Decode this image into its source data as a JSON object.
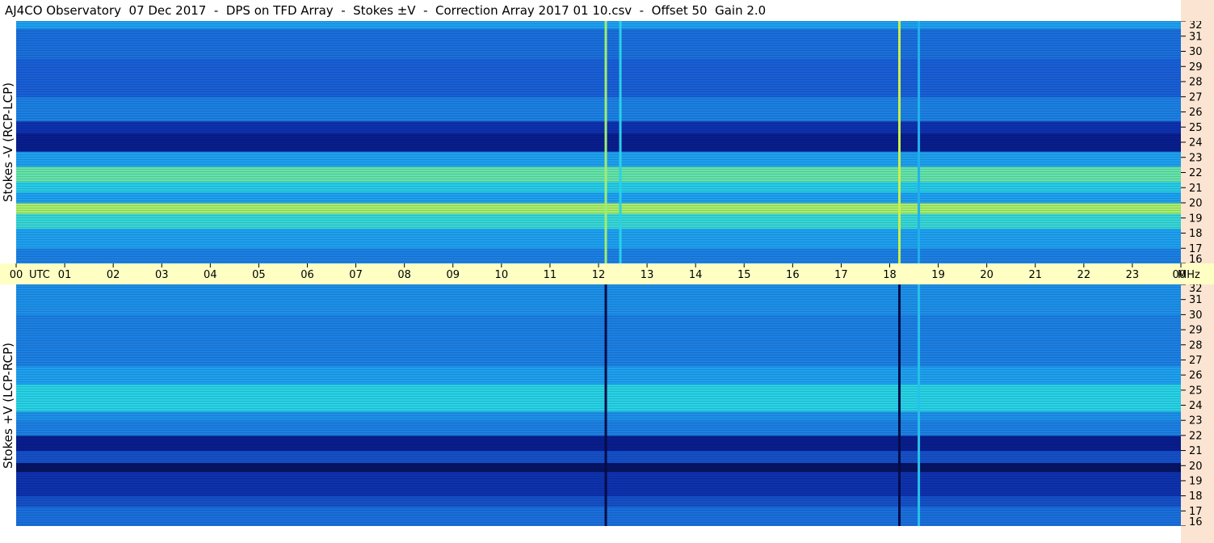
{
  "title": "AJ4CO Observatory  07 Dec 2017  -  DPS on TFD Array  -  Stokes ±V  -  Correction Array 2017 01 10.csv  -  Offset 50  Gain 2.0",
  "colors": {
    "background": "#ffffff",
    "utc_bar": "#ffffc4",
    "freq_strip": "#fbe5d2",
    "base_blue": "#1f6fd4"
  },
  "chart_data": {
    "type": "heatmap",
    "x_axis": {
      "unit_label": "UTC",
      "range_hours": [
        0,
        24
      ],
      "tick_labels": [
        "00",
        "01",
        "02",
        "03",
        "04",
        "05",
        "06",
        "07",
        "08",
        "09",
        "10",
        "11",
        "12",
        "13",
        "14",
        "15",
        "16",
        "17",
        "18",
        "19",
        "20",
        "21",
        "22",
        "23",
        "00"
      ]
    },
    "y_axis": {
      "unit_label": "MHz",
      "range_mhz": [
        16,
        32
      ],
      "tick_labels": [
        "16",
        "17",
        "18",
        "19",
        "20",
        "21",
        "22",
        "23",
        "24",
        "25",
        "26",
        "27",
        "28",
        "29",
        "30",
        "31",
        "32"
      ]
    },
    "panels": [
      {
        "label": "Stokes -V (RCP-LCP)",
        "freq_bands": [
          {
            "lo": 16.0,
            "hi": 17.0,
            "value": 0.45
          },
          {
            "lo": 17.0,
            "hi": 18.3,
            "value": 0.55
          },
          {
            "lo": 18.3,
            "hi": 19.3,
            "value": 0.72
          },
          {
            "lo": 19.3,
            "hi": 20.0,
            "value": 0.86
          },
          {
            "lo": 20.0,
            "hi": 20.7,
            "value": 0.55
          },
          {
            "lo": 20.7,
            "hi": 21.4,
            "value": 0.68
          },
          {
            "lo": 21.4,
            "hi": 22.4,
            "value": 0.78
          },
          {
            "lo": 22.4,
            "hi": 23.4,
            "value": 0.55
          },
          {
            "lo": 23.4,
            "hi": 24.6,
            "value": 0.12
          },
          {
            "lo": 24.6,
            "hi": 25.4,
            "value": 0.2
          },
          {
            "lo": 25.4,
            "hi": 27.0,
            "value": 0.45
          },
          {
            "lo": 27.0,
            "hi": 29.5,
            "value": 0.35
          },
          {
            "lo": 29.5,
            "hi": 31.5,
            "value": 0.4
          },
          {
            "lo": 31.5,
            "hi": 32.0,
            "value": 0.55
          }
        ],
        "vertical_lines": [
          {
            "utc": 12.15,
            "value": 0.85
          },
          {
            "utc": 12.45,
            "value": 0.7
          },
          {
            "utc": 18.2,
            "value": 0.9
          },
          {
            "utc": 18.6,
            "value": 0.6
          }
        ]
      },
      {
        "label": "Stokes +V (LCP-RCP)",
        "freq_bands": [
          {
            "lo": 16.0,
            "hi": 17.3,
            "value": 0.4
          },
          {
            "lo": 17.3,
            "hi": 18.0,
            "value": 0.3
          },
          {
            "lo": 18.0,
            "hi": 19.6,
            "value": 0.2
          },
          {
            "lo": 19.6,
            "hi": 20.2,
            "value": 0.05
          },
          {
            "lo": 20.2,
            "hi": 21.0,
            "value": 0.3
          },
          {
            "lo": 21.0,
            "hi": 22.0,
            "value": 0.12
          },
          {
            "lo": 22.0,
            "hi": 23.0,
            "value": 0.45
          },
          {
            "lo": 23.0,
            "hi": 23.6,
            "value": 0.5
          },
          {
            "lo": 23.6,
            "hi": 25.4,
            "value": 0.7
          },
          {
            "lo": 25.4,
            "hi": 26.6,
            "value": 0.55
          },
          {
            "lo": 26.6,
            "hi": 30.0,
            "value": 0.45
          },
          {
            "lo": 30.0,
            "hi": 32.0,
            "value": 0.5
          }
        ],
        "vertical_lines": [
          {
            "utc": 12.15,
            "value": 0.0
          },
          {
            "utc": 18.2,
            "value": 0.0
          },
          {
            "utc": 18.6,
            "value": 0.65
          }
        ]
      }
    ]
  }
}
